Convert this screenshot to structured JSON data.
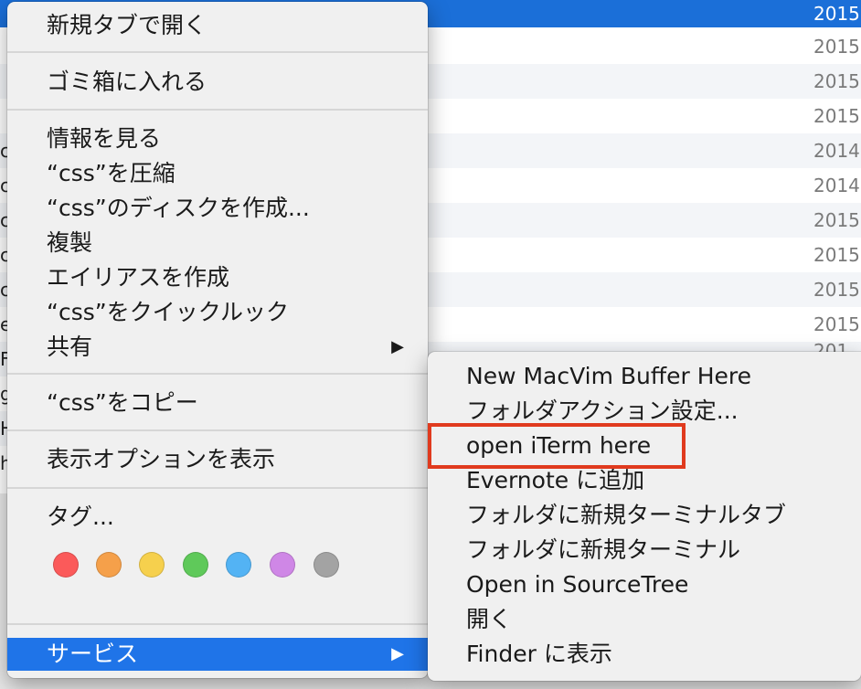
{
  "background_list": {
    "selected_year": "2015",
    "rows": [
      {
        "year": "2015",
        "letter": ""
      },
      {
        "year": "2015",
        "letter": ""
      },
      {
        "year": "2015",
        "letter": ""
      },
      {
        "year": "2014",
        "letter": "c"
      },
      {
        "year": "2014",
        "letter": "c"
      },
      {
        "year": "2015",
        "letter": "c"
      },
      {
        "year": "2015",
        "letter": "c"
      },
      {
        "year": "2015",
        "letter": "c"
      },
      {
        "year": "2015",
        "letter": "e"
      },
      {
        "year": "201",
        "letter": "F"
      },
      {
        "year": "",
        "letter": "g"
      },
      {
        "year": "",
        "letter": "H"
      },
      {
        "year": "",
        "letter": "h"
      }
    ]
  },
  "context_menu": {
    "open_new_tab": "新規タブで開く",
    "move_to_trash": "ゴミ箱に入れる",
    "get_info": "情報を見る",
    "compress": "“css”を圧縮",
    "burn_disk": "“css”のディスクを作成...",
    "duplicate": "複製",
    "make_alias": "エイリアスを作成",
    "quick_look": "“css”をクイックルック",
    "share": "共有",
    "copy": "“css”をコピー",
    "show_view_options": "表示オプションを表示",
    "tags": "タグ...",
    "services": "サービス",
    "arrow": "▶",
    "tag_colors": [
      {
        "name": "red",
        "color": "#fb5a5a"
      },
      {
        "name": "orange",
        "color": "#f5a04a"
      },
      {
        "name": "yellow",
        "color": "#f6d04d"
      },
      {
        "name": "green",
        "color": "#5fc95a"
      },
      {
        "name": "blue",
        "color": "#53b3f4"
      },
      {
        "name": "purple",
        "color": "#cf87e6"
      },
      {
        "name": "gray",
        "color": "#a3a3a3"
      }
    ]
  },
  "services_submenu": {
    "items": [
      "New MacVim Buffer Here",
      "フォルダアクション設定...",
      "open iTerm here",
      "Evernote に追加",
      "フォルダに新規ターミナルタブ",
      "フォルダに新規ターミナル",
      "Open in SourceTree",
      "開く",
      "Finder に表示"
    ]
  },
  "colors": {
    "selection_blue": "#1f74e8",
    "highlight_box_red": "#e03a1e"
  }
}
